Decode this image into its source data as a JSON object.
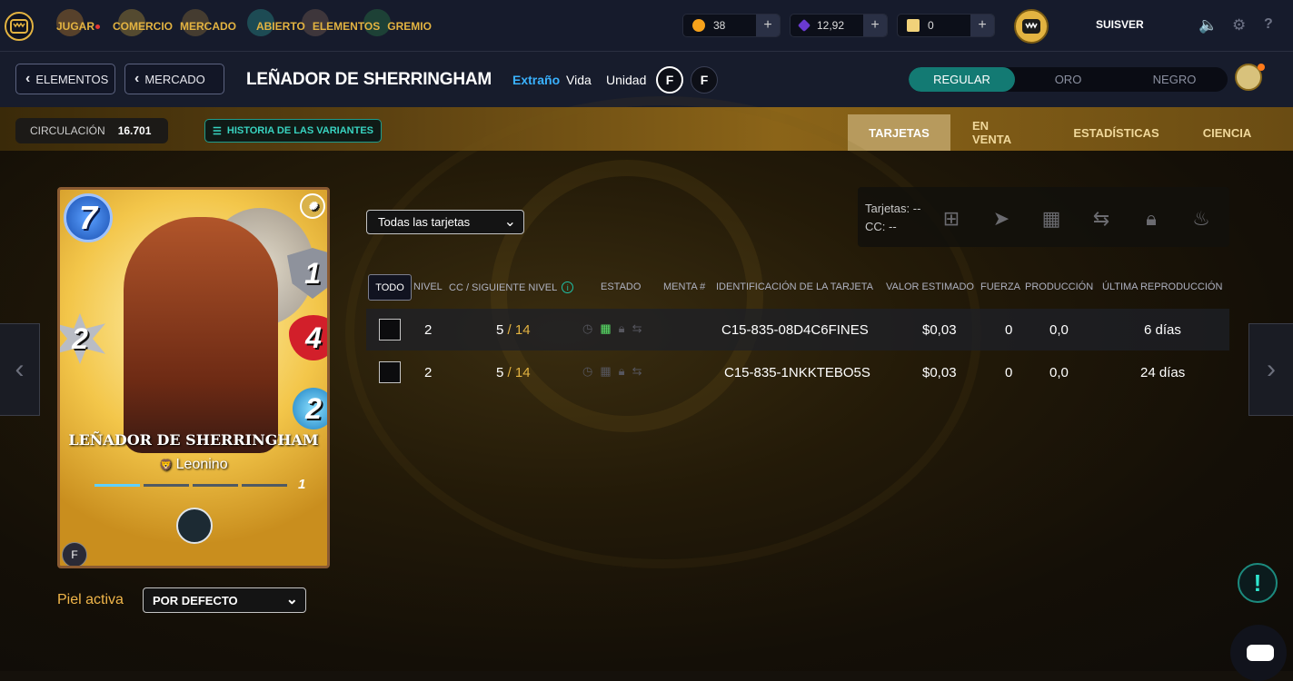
{
  "topbar": {
    "nav": [
      {
        "label": "JUGAR",
        "has_dot": true
      },
      {
        "label": "COMERCIO"
      },
      {
        "label": "MERCADO"
      },
      {
        "label": "ABIERTO"
      },
      {
        "label": "ELEMENTOS"
      },
      {
        "label": "GREMIO"
      }
    ],
    "resources": [
      {
        "name": "credits",
        "value": "38",
        "icon": "coin-icon",
        "color": "#f7a21b"
      },
      {
        "name": "dec",
        "value": "12,92",
        "icon": "crystal-icon",
        "color": "#6a3ad0"
      },
      {
        "name": "packs",
        "value": "0",
        "icon": "scroll-icon",
        "color": "#f1d27a"
      }
    ],
    "plus_label": "+",
    "username": "SUISVER"
  },
  "header": {
    "back_elements": "ELEMENTOS",
    "back_market": "MERCADO",
    "card_title": "LEÑADOR DE SHERRINGHAM",
    "rarity": "Extraño",
    "element": "Vida",
    "type": "Unidad",
    "edition_glyph": "F",
    "variants": [
      "REGULAR",
      "ORO",
      "NEGRO"
    ],
    "variant_selected": "REGULAR"
  },
  "goldbar": {
    "circulation_label": "CIRCULACIÓN",
    "circulation_value": "16.701",
    "history_label": "HISTORIA DE LAS VARIANTES",
    "tabs": [
      "TARJETAS",
      "EN VENTA",
      "ESTADÍSTICAS",
      "CIENCIA"
    ],
    "active_tab": "TARJETAS"
  },
  "card": {
    "mana": "7",
    "armor": "1",
    "attack": "2",
    "health": "4",
    "speed": "2",
    "name": "LEÑADOR DE SHERRINGHAM",
    "race": "Leonino",
    "level": "1",
    "level_progress": 0.25
  },
  "skin": {
    "label": "Piel activa",
    "value": "POR DEFECTO"
  },
  "table": {
    "filter": "Todas las tarjetas",
    "summary_cards": "Tarjetas: --",
    "summary_cp": "CC: --",
    "select_all": "TODO",
    "columns": {
      "level": "NIVEL",
      "cp": "CC / SIGUIENTE NIVEL",
      "state": "ESTADO",
      "mint": "MENTA #",
      "id": "IDENTIFICACIÓN DE LA TARJETA",
      "value": "VALOR ESTIMADO",
      "power": "FUERZA",
      "production": "PRODUCCIÓN",
      "last": "ÚLTIMA REPRODUCCIÓN"
    },
    "rows": [
      {
        "level": "2",
        "cp": "5",
        "cp_next": "/ 14",
        "id": "C15-835-08D4C6FINES",
        "value": "$0,03",
        "power": "0",
        "production": "0,0",
        "last": "6 días",
        "state_store_active": true
      },
      {
        "level": "2",
        "cp": "5",
        "cp_next": "/ 14",
        "id": "C15-835-1NKKTEBO5S",
        "value": "$0,03",
        "power": "0",
        "production": "0,0",
        "last": "24 días",
        "state_store_active": false
      }
    ]
  },
  "colors": {
    "accent_gold": "#e3b341",
    "teal": "#137a73",
    "rarity_blue": "#3ab2ff"
  }
}
